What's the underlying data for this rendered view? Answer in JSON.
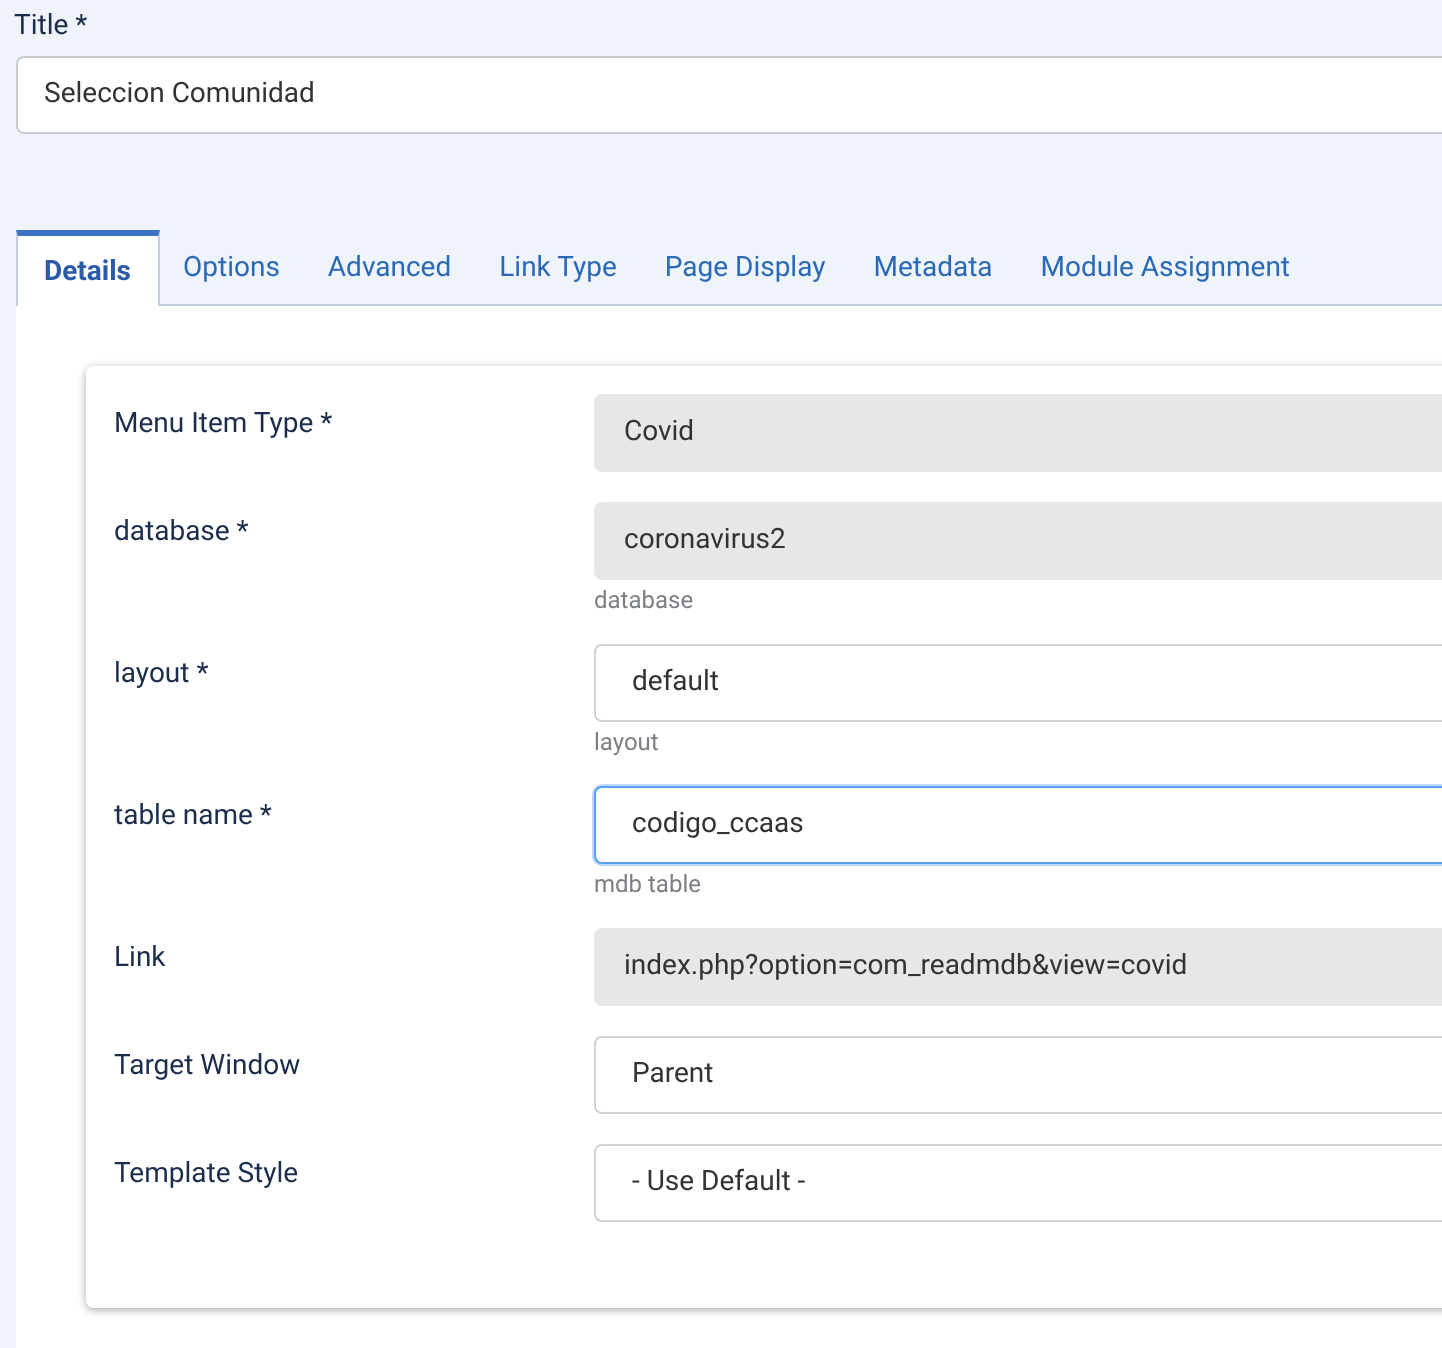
{
  "title_field": {
    "label": "Title *",
    "value": "Seleccion Comunidad"
  },
  "tabs": [
    {
      "label": "Details",
      "selected": true
    },
    {
      "label": "Options",
      "selected": false
    },
    {
      "label": "Advanced",
      "selected": false
    },
    {
      "label": "Link Type",
      "selected": false
    },
    {
      "label": "Page Display",
      "selected": false
    },
    {
      "label": "Metadata",
      "selected": false
    },
    {
      "label": "Module Assignment",
      "selected": false
    }
  ],
  "fields": [
    {
      "label": "Menu Item Type *",
      "kind": "readonly",
      "value": "Covid",
      "focused": false
    },
    {
      "label": "database *",
      "kind": "readonly",
      "value": "coronavirus2",
      "hint": "database",
      "focused": false
    },
    {
      "label": "layout *",
      "kind": "select",
      "value": "default",
      "hint": "layout",
      "focused": false
    },
    {
      "label": "table name *",
      "kind": "select",
      "value": "codigo_ccaas",
      "hint": "mdb table",
      "focused": true
    },
    {
      "label": "Link",
      "kind": "readonly",
      "value": "index.php?option=com_readmdb&view=covid",
      "focused": false
    },
    {
      "label": "Target Window",
      "kind": "select",
      "value": "Parent",
      "focused": false
    },
    {
      "label": "Template Style",
      "kind": "select",
      "value": "- Use Default -",
      "focused": false
    }
  ]
}
